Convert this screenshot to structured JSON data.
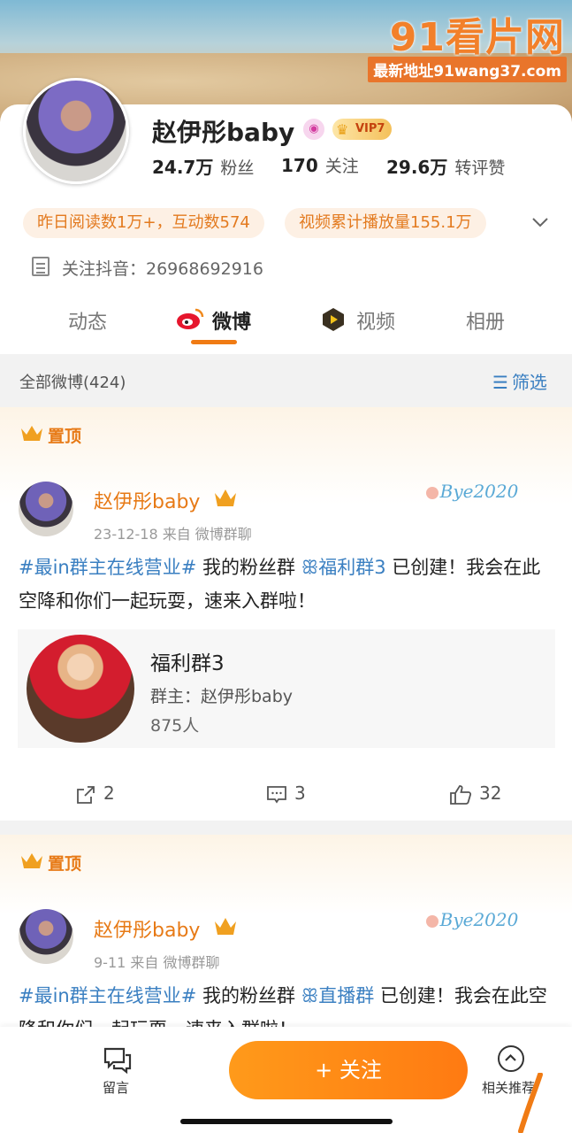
{
  "watermark": {
    "logo": "91看片网",
    "url": "最新地址91wang37.com"
  },
  "profile": {
    "name": "赵伊彤baby",
    "vip": "VIP7",
    "stats": {
      "fans_num": "24.7万",
      "fans_lbl": "粉丝",
      "follow_num": "170",
      "follow_lbl": "关注",
      "reposts_num": "29.6万",
      "reposts_lbl": "转评赞"
    },
    "chips": {
      "reads": "昨日阅读数1万+，互动数574",
      "views": "视频累计播放量155.1万"
    },
    "note": "关注抖音：26968692916"
  },
  "tabs": {
    "dongtai": "动态",
    "weibo": "微博",
    "shipin": "视频",
    "xiangce": "相册"
  },
  "filter": {
    "all": "全部微博(424)",
    "button": "筛选"
  },
  "posts": [
    {
      "pin": "置顶",
      "author": "赵伊彤baby",
      "meta": "23-12-18  来自 微博群聊",
      "topic": "#最in群主在线营业#",
      "text_a": " 我的粉丝群 ",
      "group_link": "ꕥ福利群3",
      "text_b": " 已创建！我会在此空降和你们一起玩耍，速来入群啦！",
      "bye": "Bye2020",
      "group_card": {
        "name": "福利群3",
        "owner": "群主：赵伊彤baby",
        "count": "875人"
      },
      "actions": {
        "repost": "2",
        "comment": "3",
        "like": "32"
      }
    },
    {
      "pin": "置顶",
      "author": "赵伊彤baby",
      "meta": "9-11  来自 微博群聊",
      "topic": "#最in群主在线营业#",
      "text_a": " 我的粉丝群 ",
      "group_link": "ꕥ直播群",
      "text_b": " 已创建！我会在此空降和你们一起玩耍，速来入群啦！",
      "bye": "Bye2020"
    }
  ],
  "bottom": {
    "message": "留言",
    "follow": "+ 关注",
    "related": "相关推荐"
  },
  "colors": {
    "accent": "#f07b14",
    "link": "#3a7fc1",
    "chip_bg": "#fdf0e4"
  }
}
